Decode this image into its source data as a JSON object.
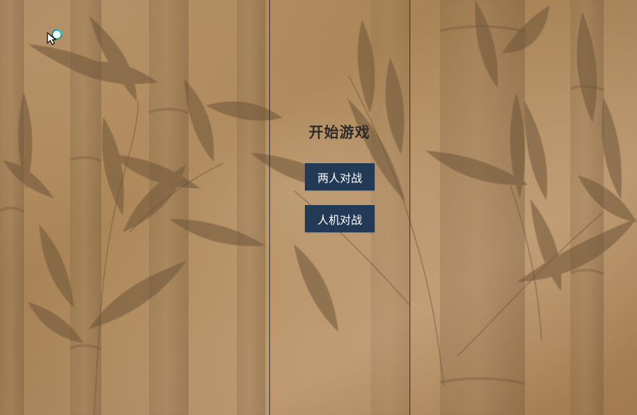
{
  "menu": {
    "title": "开始游戏",
    "buttons": [
      {
        "label": "两人对战"
      },
      {
        "label": "人机对战"
      }
    ]
  },
  "colors": {
    "button_background": "#233a56",
    "button_text": "#ffffff",
    "title_text": "#2e2a26",
    "paper_background": "#b8956b",
    "bamboo_shadow": "#6f5639",
    "divider": "#2f241a"
  },
  "icons": {
    "cursor": "mouse-pointer-icon",
    "busy": "loading-spinner-icon"
  }
}
